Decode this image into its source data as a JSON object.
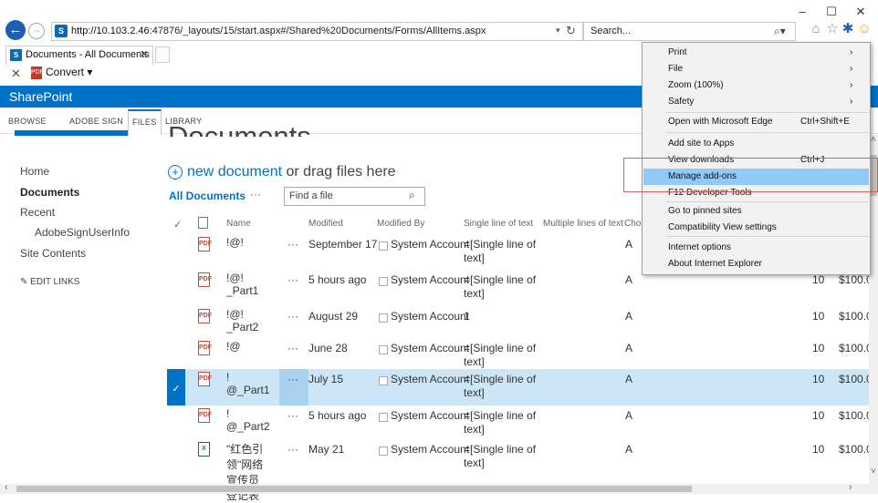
{
  "browser": {
    "url_host": "http://10.103.2.46",
    "url_rest": ":47876/_layouts/15/start.aspx#/Shared%20Documents/Forms/AllItems.aspx",
    "search_placeholder": "Search...",
    "tab_title": "Documents - All Documents",
    "convert_label": "Convert",
    "minimize": "–",
    "maximize": "☐",
    "close": "✕"
  },
  "sharepoint": {
    "brand": "SharePoint",
    "ribbon_tabs": [
      "BROWSE",
      "ADOBE SIGN",
      "FILES",
      "LIBRARY"
    ],
    "page_title": "Documents"
  },
  "nav": {
    "items": [
      "Home",
      "Documents",
      "Recent",
      "AdobeSignUserInfo",
      "Site Contents"
    ],
    "edit_links": "EDIT LINKS"
  },
  "library": {
    "new_document": "new document",
    "drag_text": " or drag files here",
    "view_name": "All Documents",
    "view_more": "···",
    "find_placeholder": "Find a file",
    "columns": [
      "Name",
      "Modified",
      "Modified By",
      "Single line of text",
      "Multiple lines of text",
      "Choi",
      "ncy"
    ],
    "rows": [
      {
        "name1": "!@!",
        "name2": "",
        "modified": "September 17",
        "by": "System Account",
        "single1": "=[Single line of",
        "single2": "text]",
        "choice": "A",
        "num": "",
        "currency": "$100.0(",
        "type": "pdf"
      },
      {
        "name1": "!@!",
        "name2": "_Part1",
        "modified": "5 hours ago",
        "by": "System Account",
        "single1": "=[Single line of",
        "single2": "text]",
        "choice": "A",
        "num": "10",
        "currency": "$100.0(",
        "type": "pdf"
      },
      {
        "name1": "!@!",
        "name2": "_Part2",
        "modified": "August 29",
        "by": "System Account",
        "single1": "1",
        "single2": "",
        "choice": "A",
        "num": "10",
        "currency": "$100.0(",
        "type": "pdf"
      },
      {
        "name1": "!@",
        "name2": "",
        "modified": "June 28",
        "by": "System Account",
        "single1": "=[Single line of",
        "single2": "text]",
        "choice": "A",
        "num": "10",
        "currency": "$100.0(",
        "type": "pdf"
      },
      {
        "name1": "!",
        "name2": "@_Part1",
        "modified": "July 15",
        "by": "System Account",
        "single1": "=[Single line of",
        "single2": "text]",
        "choice": "A",
        "num": "10",
        "currency": "$100.0(",
        "type": "pdf",
        "selected": true
      },
      {
        "name1": "!",
        "name2": "@_Part2",
        "modified": "5 hours ago",
        "by": "System Account",
        "single1": "=[Single line of",
        "single2": "text]",
        "choice": "A",
        "num": "10",
        "currency": "$100.0(",
        "type": "pdf"
      },
      {
        "name1": "\"红色引",
        "name2": "领\"网络",
        "name3": "宣传员",
        "name4": "登记表",
        "modified": "May 21",
        "by": "System Account",
        "single1": "=[Single line of",
        "single2": "text]",
        "choice": "A",
        "num": "10",
        "currency": "$100.0(",
        "type": "xl"
      }
    ]
  },
  "menu": {
    "items": [
      {
        "label": "Print",
        "shortcut": "",
        "arrow": "›"
      },
      {
        "label": "File",
        "shortcut": "",
        "arrow": "›"
      },
      {
        "label": "Zoom (100%)",
        "shortcut": "",
        "arrow": "›"
      },
      {
        "label": "Safety",
        "shortcut": "",
        "arrow": "›"
      },
      {
        "label": "Open with Microsoft Edge",
        "shortcut": "Ctrl+Shift+E",
        "arrow": ""
      },
      {
        "label": "Add site to Apps",
        "shortcut": "",
        "arrow": ""
      },
      {
        "label": "View downloads",
        "shortcut": "Ctrl+J",
        "arrow": ""
      },
      {
        "label": "Manage add-ons",
        "shortcut": "",
        "arrow": "",
        "highlighted": true
      },
      {
        "label": "F12 Developer Tools",
        "shortcut": "",
        "arrow": ""
      },
      {
        "label": "Go to pinned sites",
        "shortcut": "",
        "arrow": ""
      },
      {
        "label": "Compatibility View settings",
        "shortcut": "",
        "arrow": ""
      },
      {
        "label": "Internet options",
        "shortcut": "",
        "arrow": ""
      },
      {
        "label": "About Internet Explorer",
        "shortcut": "",
        "arrow": ""
      }
    ]
  },
  "colors": {
    "accent": "#0072c6",
    "highlight": "#91c9f7",
    "selected_row": "#cde6f7",
    "annotation": "#e05a5a"
  }
}
